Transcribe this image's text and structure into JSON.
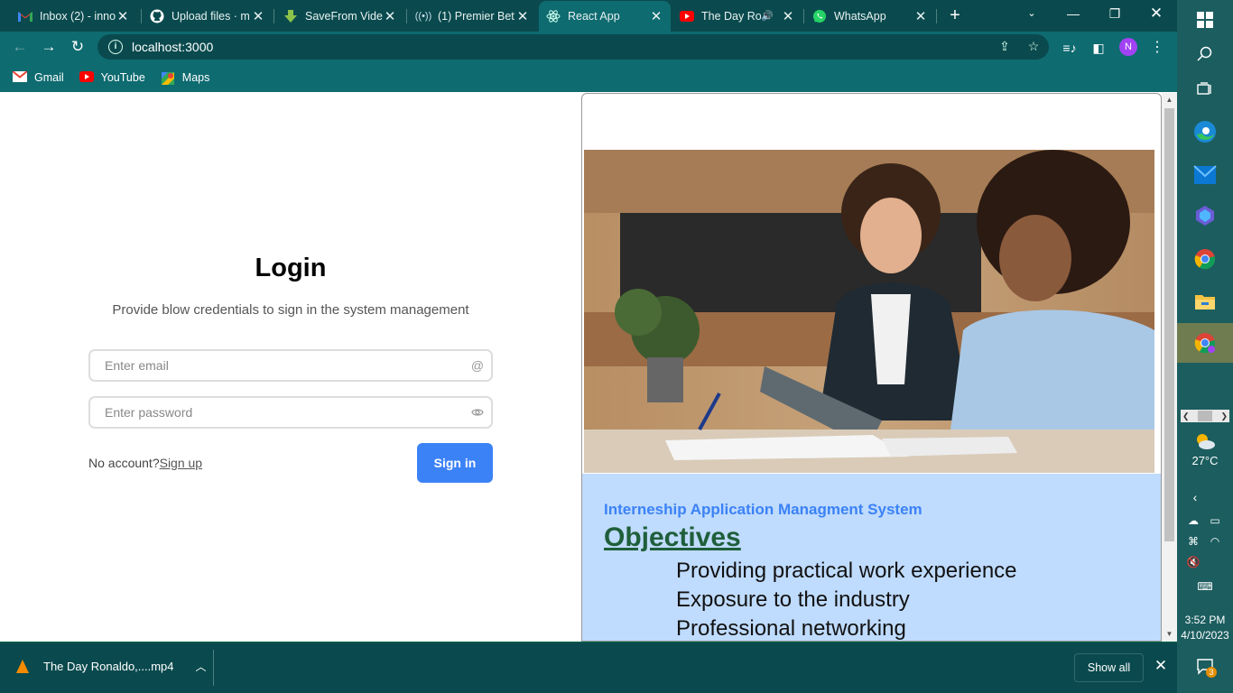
{
  "tabs": [
    {
      "title": "Inbox (2) - inno",
      "icon": "gmail-icon"
    },
    {
      "title": "Upload files · m",
      "icon": "github-icon"
    },
    {
      "title": "SaveFrom Vide",
      "icon": "download-icon"
    },
    {
      "title": "(1) Premier Bet!",
      "icon": "premier-bet-icon"
    },
    {
      "title": "React App",
      "icon": "react-icon",
      "active": true
    },
    {
      "title": "The Day Ro",
      "icon": "youtube-icon"
    },
    {
      "title": "WhatsApp",
      "icon": "whatsapp-icon"
    }
  ],
  "address": {
    "url": "localhost:3000"
  },
  "profile": {
    "initial": "N"
  },
  "bookmarks": [
    {
      "label": "Gmail",
      "icon": "gmail-icon"
    },
    {
      "label": "YouTube",
      "icon": "youtube-icon"
    },
    {
      "label": "Maps",
      "icon": "maps-icon"
    }
  ],
  "login": {
    "title": "Login",
    "subtitle": "Provide blow credentials to sign in the system management",
    "email_placeholder": "Enter email",
    "password_placeholder": "Enter password",
    "no_account": "No account?",
    "signup_label": "Sign up",
    "signin_label": "Sign in"
  },
  "info": {
    "title": "Interneship Application Managment System",
    "objectives_heading": "Objectives",
    "objectives": [
      "Providing practical work experience",
      "Exposure to the industry",
      "Professional networking"
    ]
  },
  "downloads": {
    "filename": "The Day Ronaldo,....mp4",
    "show_all": "Show all"
  },
  "taskbar": {
    "temperature": "27°C",
    "time": "3:52 PM",
    "date": "4/10/2023",
    "notifications": "3"
  },
  "colors": {
    "chrome_dark": "#0a4a4e",
    "chrome": "#0e6b70",
    "primary": "#3b82f6",
    "panel": "#bfdbfe",
    "objectives": "#1f5f3a"
  }
}
